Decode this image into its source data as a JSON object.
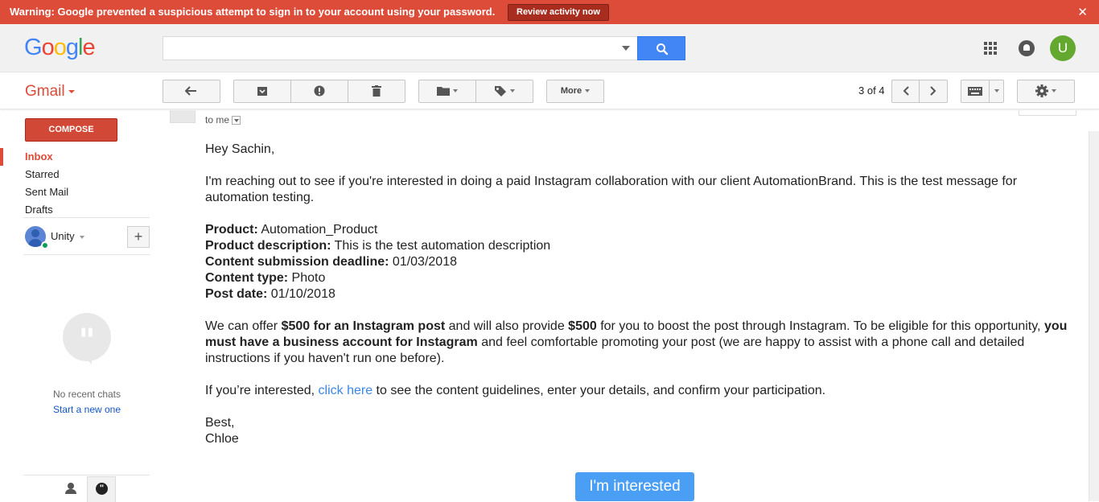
{
  "warning": {
    "message": "Warning: Google prevented a suspicious attempt to sign in to your account using your password.",
    "button": "Review activity now",
    "close": "✕"
  },
  "header": {
    "logo": [
      "G",
      "o",
      "o",
      "g",
      "l",
      "e"
    ],
    "search": {
      "value": "",
      "placeholder": ""
    },
    "avatar_letter": "U"
  },
  "toolbar": {
    "app_label": "Gmail",
    "more_label": "More",
    "pager": "3 of 4",
    "icons": [
      "back-arrow-icon",
      "archive-icon",
      "report-spam-icon",
      "delete-icon",
      "folder-icon",
      "label-icon",
      "chevron-left-icon",
      "chevron-right-icon",
      "keyboard-icon",
      "gear-icon"
    ]
  },
  "sidebar": {
    "compose_label": "COMPOSE",
    "items": [
      {
        "label": "Inbox",
        "active": true
      },
      {
        "label": "Starred",
        "active": false
      },
      {
        "label": "Sent Mail",
        "active": false
      },
      {
        "label": "Drafts",
        "active": false
      }
    ],
    "account_name": "Unity",
    "chat_empty": "No recent chats",
    "chat_start": "Start a new one"
  },
  "message": {
    "recipient": "to me",
    "greeting": "Hey Sachin,",
    "intro": "I'm reaching out to see if you're interested in doing a paid Instagram collaboration with our client AutomationBrand. This is the test message for automation testing.",
    "details": [
      {
        "label": "Product:",
        "value": " Automation_Product"
      },
      {
        "label": "Product description:",
        "value": " This is the test automation description"
      },
      {
        "label": "Content submission deadline:",
        "value": " 01/03/2018"
      },
      {
        "label": "Content type:",
        "value": " Photo"
      },
      {
        "label": "Post date:",
        "value": " 01/10/2018"
      }
    ],
    "offer": {
      "t1": "We can offer ",
      "b1": "$500 for an Instagram post",
      "t2": " and will also provide ",
      "b2": "$500",
      "t3": " for you to boost the post through Instagram. To be eligible for this opportunity, ",
      "b3": "you must have a business account for Instagram",
      "t4": " and feel comfortable promoting your post (we are happy to assist with a phone call and detailed instructions if you haven't run one before)."
    },
    "cta_line": {
      "before": "If you’re interested, ",
      "link": "click here",
      "after": " to see the content guidelines, enter your details, and confirm your participation."
    },
    "signoff": "Best,",
    "signature": "Chloe",
    "cta_button": "I'm interested"
  },
  "colors": {
    "warning_bg": "#dd4b39",
    "compose_bg": "#d14836",
    "search_btn": "#4285f4",
    "cta_bg": "#4a9ff5",
    "link": "#3b86e6",
    "avatar_bg": "#65a830"
  }
}
